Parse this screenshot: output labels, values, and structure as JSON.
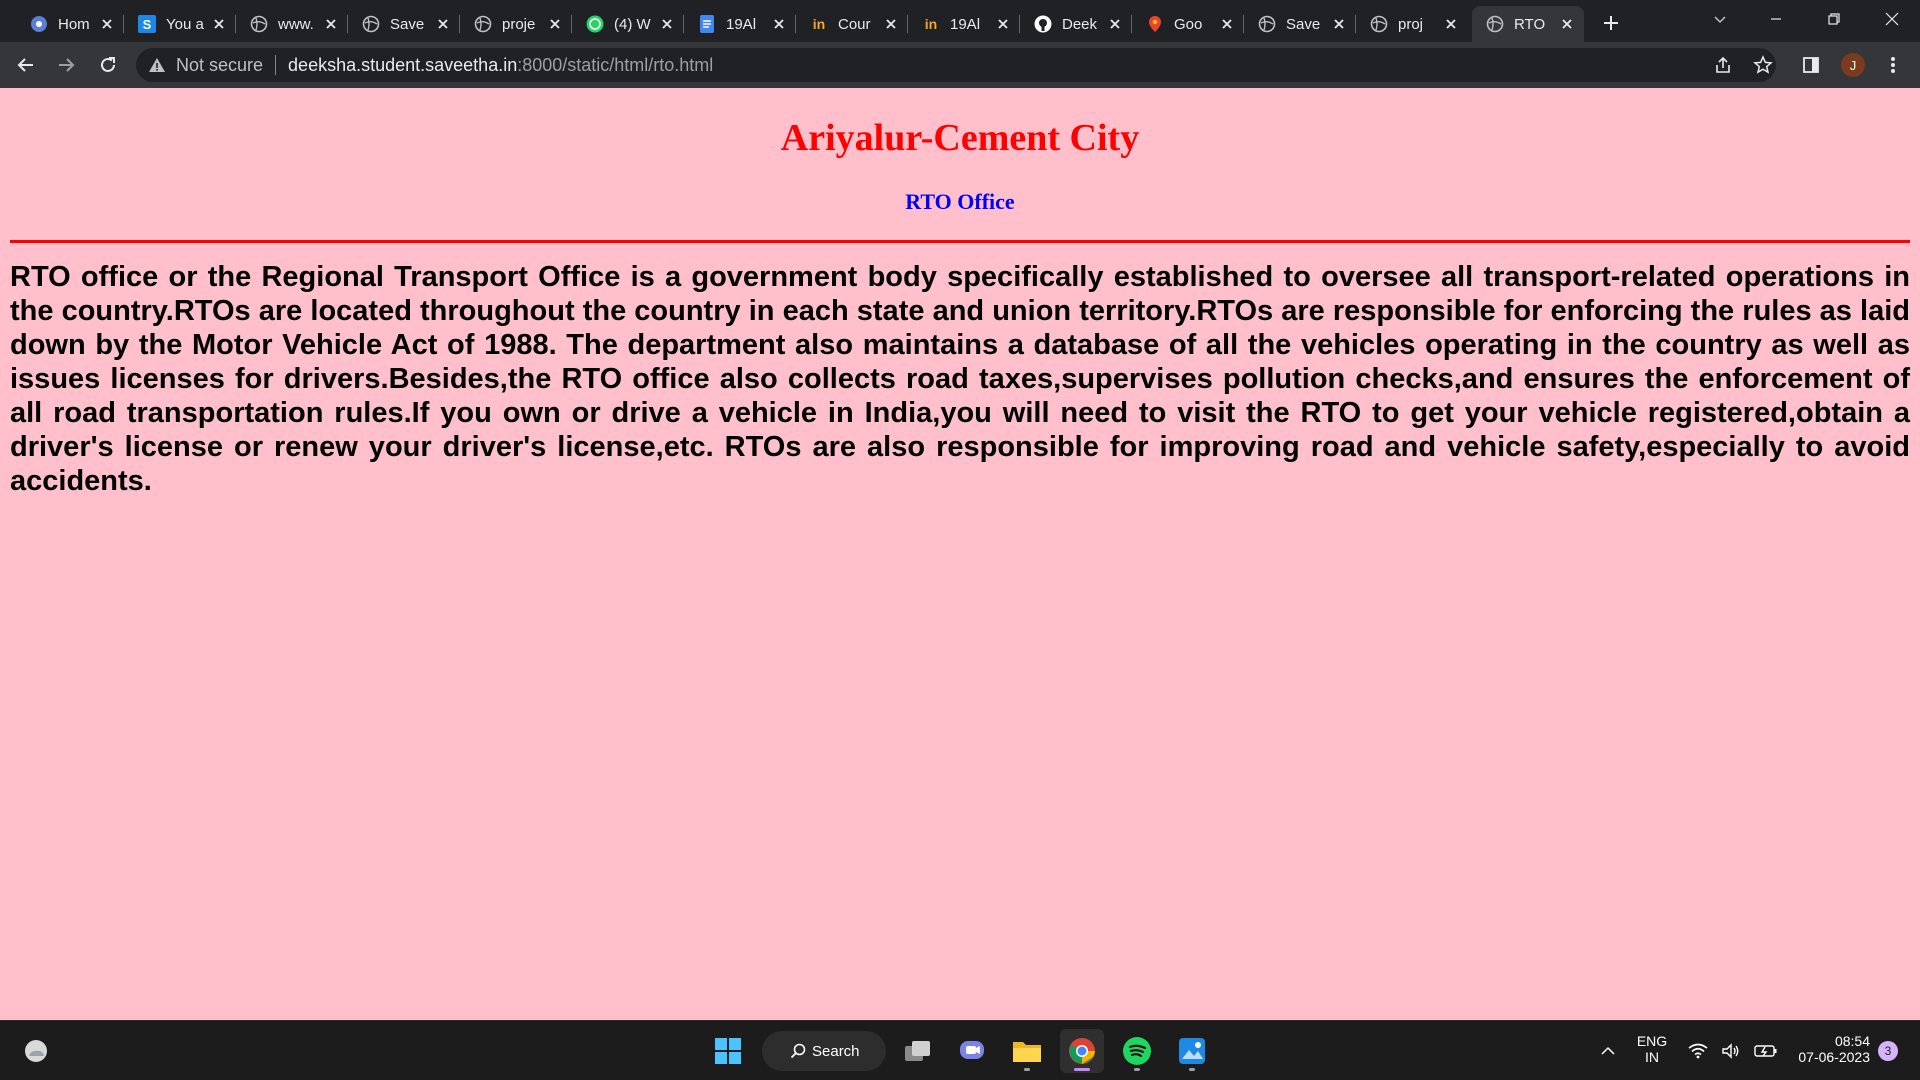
{
  "browser": {
    "tabs": [
      {
        "title": "Hom",
        "icon": "app-icon"
      },
      {
        "title": "You a",
        "icon": "s-icon"
      },
      {
        "title": "www.",
        "icon": "globe-icon"
      },
      {
        "title": "Save",
        "icon": "globe-icon"
      },
      {
        "title": "proje",
        "icon": "globe-icon"
      },
      {
        "title": "(4) W",
        "icon": "whatsapp-icon"
      },
      {
        "title": "19Al",
        "icon": "docs-icon"
      },
      {
        "title": "Cour",
        "icon": "in-icon"
      },
      {
        "title": "19Al",
        "icon": "in-icon"
      },
      {
        "title": "Deek",
        "icon": "github-icon"
      },
      {
        "title": "Goo",
        "icon": "maps-icon"
      },
      {
        "title": "Save",
        "icon": "globe-icon"
      },
      {
        "title": "proj",
        "icon": "globe-icon"
      },
      {
        "title": "RTO",
        "icon": "globe-icon",
        "active": true
      }
    ],
    "security_label": "Not secure",
    "url_host": "deeksha.student.saveetha.in",
    "url_path": ":8000/static/html/rto.html",
    "profile_initial": "J"
  },
  "page": {
    "title": "Ariyalur-Cement City",
    "subtitle": "RTO Office",
    "body": "RTO office or the Regional Transport Office is a government body specifically established to oversee all transport-related operations in the country.RTOs are located throughout the country in each state and union territory.RTOs are responsible for enforcing the rules as laid down by the Motor Vehicle Act of 1988. The department also maintains a database of all the vehicles operating in the country as well as issues licenses for drivers.Besides,the RTO office also collects road taxes,supervises pollution checks,and ensures the enforcement of all road transportation rules.If you own or drive a vehicle in India,you will need to visit the RTO to get your vehicle registered,obtain a driver's license or renew your driver's license,etc. RTOs are also responsible for improving road and vehicle safety,especially to avoid accidents.",
    "colors": {
      "background": "#ffc0cb",
      "title": "#ff0000",
      "subtitle": "#0000ff",
      "rule": "#ff0000"
    }
  },
  "taskbar": {
    "search_label": "Search",
    "lang_line1": "ENG",
    "lang_line2": "IN",
    "time": "08:54",
    "date": "07-06-2023",
    "notification_count": "3"
  }
}
